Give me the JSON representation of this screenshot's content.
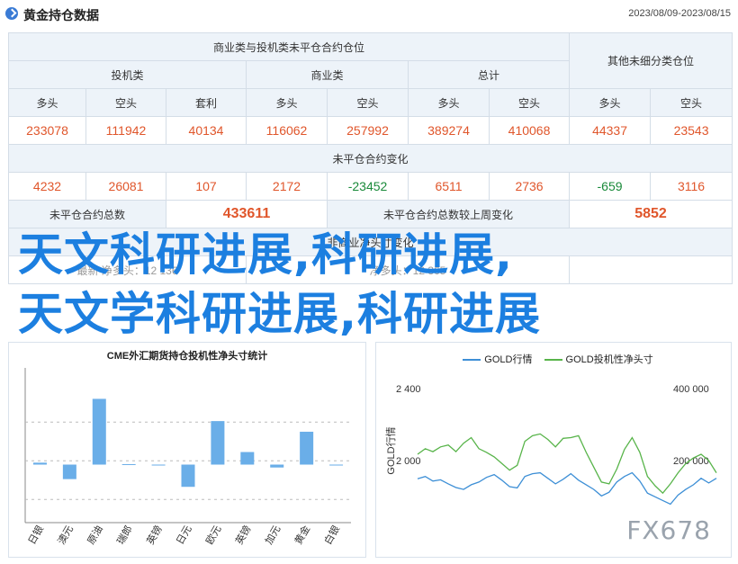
{
  "header": {
    "title": "黄金持仓数据",
    "range": "2023/08/09-2023/08/15"
  },
  "table": {
    "group_a": "商业类与投机类未平仓合约仓位",
    "group_b": "其他未细分类仓位",
    "spec": "投机类",
    "comm": "商业类",
    "total": "总计",
    "long": "多头",
    "short": "空头",
    "spread": "套利",
    "row1": [
      "233078",
      "111942",
      "40134",
      "116062",
      "257992",
      "389274",
      "410068",
      "44337",
      "23543"
    ],
    "change_title": "未平仓合约变化",
    "row2": [
      "4232",
      "26081",
      "107",
      "2172",
      "-23452",
      "6511",
      "2736",
      "-659",
      "3116"
    ],
    "oi_total_label": "未平仓合约总数",
    "oi_total": "433611",
    "oi_change_label": "未平仓合约总数较上周变化",
    "oi_change": "5852",
    "partial_title": "非商业净头寸变化",
    "partial_left1": "最新",
    "partial_left2": "净多头：12 136",
    "partial_mid": "净多头：12 365"
  },
  "overlay": {
    "line1": "天文科研进展,科研进展,",
    "line2": "天文学科研进展,科研进展"
  },
  "chart_left": {
    "title": "CME外汇期货持仓投机性净头寸统计"
  },
  "chart_right": {
    "legend_a": "GOLD行情",
    "legend_b": "GOLD投机性净头寸",
    "ylabel": "GOLD行情"
  },
  "watermark": "FX678",
  "colors": {
    "accent": "#3a7bd5",
    "positive": "#e0562b",
    "negative": "#1a8a3a",
    "bar": "#6aaee8",
    "line_a": "#3d8fd6",
    "line_b": "#58b44a",
    "overlay": "#1c7fe0"
  },
  "chart_data": [
    {
      "type": "bar",
      "title": "CME外汇期货持仓投机性净头寸统计",
      "categories": [
        "日银",
        "澳元",
        "原油",
        "瑞郎",
        "英镑",
        "日元",
        "欧元",
        "英镑",
        "加元",
        "黄金",
        "白银"
      ],
      "values": [
        0.02,
        -0.15,
        0.68,
        0.005,
        0,
        -0.23,
        0.45,
        0.13,
        -0.03,
        0.34,
        0
      ],
      "ylim": [
        -0.6,
        1
      ]
    },
    {
      "type": "line",
      "ylabel": "GOLD行情",
      "y_left_ticks": [
        "2 400",
        "2 000"
      ],
      "y_right_ticks": [
        "400 000",
        "200 000"
      ],
      "y_left_lim": [
        1800,
        2500
      ],
      "y_right_lim": [
        80000,
        430000
      ],
      "series": [
        {
          "name": "GOLD行情",
          "values": [
            2018,
            2030,
            2005,
            2012,
            1990,
            1970,
            1960,
            1985,
            2000,
            2025,
            2040,
            2010,
            1975,
            1968,
            2030,
            2045,
            2050,
            2020,
            1990,
            2015,
            2045,
            2010,
            1985,
            1960,
            1925,
            1945,
            2000,
            2030,
            2050,
            2005,
            1940,
            1920,
            1900,
            1880,
            1930,
            1960,
            1985,
            2020,
            1995,
            2020
          ]
        },
        {
          "name": "GOLD投机性净头寸",
          "values": [
            255000,
            270000,
            262000,
            275000,
            280000,
            262000,
            285000,
            300000,
            270000,
            260000,
            248000,
            230000,
            212000,
            225000,
            290000,
            305000,
            310000,
            295000,
            275000,
            298000,
            300000,
            305000,
            260000,
            220000,
            180000,
            175000,
            215000,
            268000,
            300000,
            260000,
            195000,
            170000,
            150000,
            175000,
            205000,
            230000,
            245000,
            255000,
            238000,
            205000
          ]
        }
      ]
    }
  ]
}
